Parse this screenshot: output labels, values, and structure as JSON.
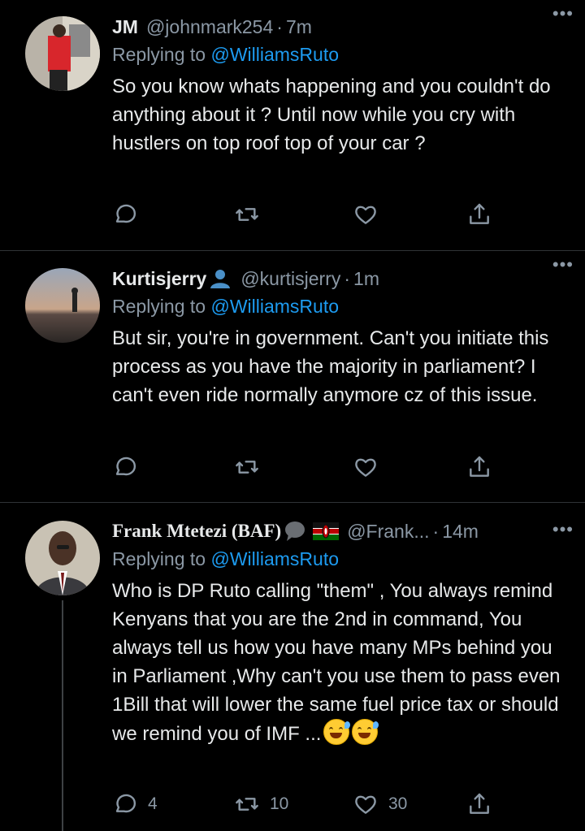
{
  "tweets": [
    {
      "name": "JM",
      "handle": "@johnmark254",
      "time": "7m",
      "replying_prefix": "Replying to ",
      "replying_to": "@WilliamsRuto",
      "text": "So you know whats happening and you couldn't do anything about it ? Until now while you cry with hustlers on top roof top of your car ?",
      "more": "•••",
      "replies": "",
      "retweets": "",
      "likes": ""
    },
    {
      "name": "Kurtisjerry",
      "handle": "@kurtisjerry",
      "time": "1m",
      "replying_prefix": "Replying to ",
      "replying_to": "@WilliamsRuto",
      "text": "But sir, you're in government. Can't you initiate this process as you have the majority in parliament? I can't even ride normally anymore cz of this issue.",
      "more": "•••",
      "replies": "",
      "retweets": "",
      "likes": ""
    },
    {
      "name": "Frank Mtetezi (BAF)",
      "handle": "@Frank...",
      "time": "14m",
      "replying_prefix": "Replying to ",
      "replying_to": "@WilliamsRuto",
      "text": "Who is DP Ruto calling \"them\" , You always remind Kenyans that you are the 2nd in command, You always tell us how you have many MPs behind you in Parliament ,Why can't  you use them to pass even 1Bill that will lower  the same fuel price tax or should we remind you of IMF ...",
      "more": "•••",
      "replies": "4",
      "retweets": "10",
      "likes": "30"
    }
  ],
  "colors": {
    "background": "#000000",
    "text": "#e7e9ea",
    "secondary": "#8b98a5",
    "link": "#1d9bf0",
    "divider": "#2f3336"
  },
  "icons": {
    "reply": "speech-bubble-icon",
    "retweet": "retweet-icon",
    "like": "heart-icon",
    "share": "share-icon",
    "more": "more-dots-icon"
  }
}
